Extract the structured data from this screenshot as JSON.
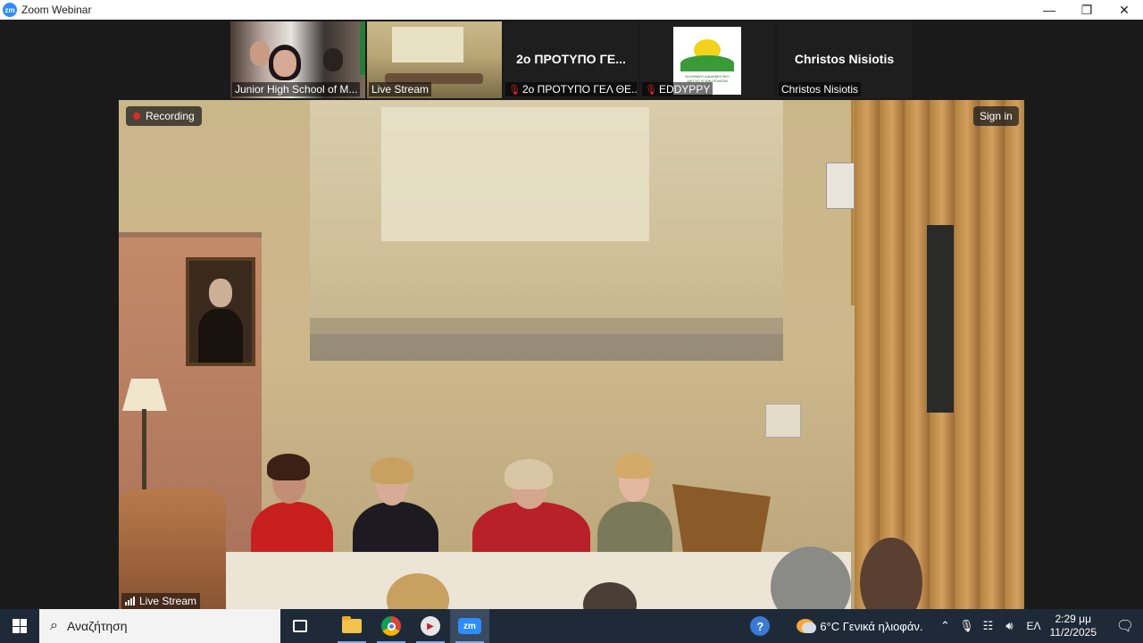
{
  "window": {
    "logo_text": "zm",
    "title": "Zoom Webinar",
    "minimize": "—",
    "restore": "❐",
    "close": "✕"
  },
  "thumbnails": [
    {
      "label": "Junior High School of M...",
      "type": "video",
      "muted": false
    },
    {
      "label": "Live Stream",
      "type": "video",
      "muted": false,
      "active": true
    },
    {
      "label": "2ο ΠΡΟΤΥΠΟ ΓΕΛ ΘΕ...",
      "display_name": "2ο ΠΡΟΤΥΠΟ ΓΕ...",
      "type": "name",
      "muted": true
    },
    {
      "label": "EDDYPPY",
      "type": "logo",
      "muted": true
    },
    {
      "label": "Christos Nisiotis",
      "display_name": "Christos Nisiotis",
      "type": "name",
      "muted": false
    }
  ],
  "main": {
    "recording_label": "Recording",
    "signin_label": "Sign in",
    "live_label": "Live Stream"
  },
  "taskbar": {
    "search_placeholder": "Αναζήτηση",
    "zoom_label": "zm",
    "weather": "6°C  Γενικά ηλιοφάν.",
    "lang": "ΕΛ",
    "time": "2:29 μμ",
    "date": "11/2/2025"
  },
  "colors": {
    "accent": "#2d8cff",
    "recording": "#e02828",
    "taskbar": "#1f2a38"
  }
}
